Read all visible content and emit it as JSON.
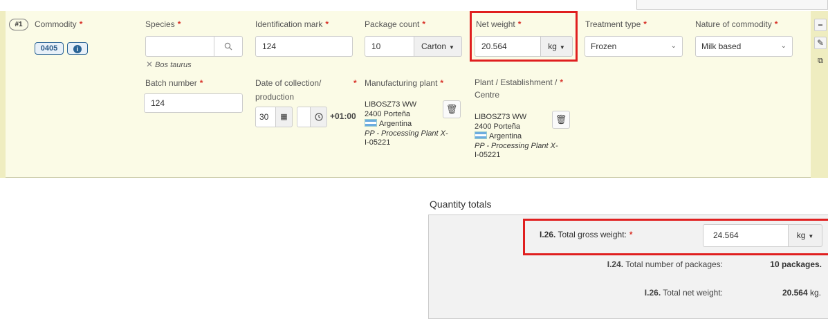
{
  "commodity_row": {
    "index": "#1",
    "commodity_label": "Commodity",
    "commodity_code": "0405",
    "info_icon": "info-icon",
    "species_label": "Species",
    "species_value": "",
    "species_selected": "Bos taurus",
    "id_mark_label": "Identification mark",
    "id_mark_value": "124",
    "package_count_label": "Package count",
    "package_count_value": "10",
    "package_unit": "Carton",
    "net_weight_label": "Net weight",
    "net_weight_value": "20.564",
    "net_weight_unit": "kg",
    "treatment_label": "Treatment type",
    "treatment_value": "Frozen",
    "nature_label": "Nature of commodity",
    "nature_value": "Milk based",
    "batch_label": "Batch number",
    "batch_value": "124",
    "date_label_line1": "Date of collection/",
    "date_label_line2": "production",
    "date_day_value": "30",
    "date_time_value": "",
    "timezone": "+01:00",
    "mfg_plant_label": "Manufacturing plant",
    "mfg_plant": {
      "name": "LIBOSZ73 WW",
      "city": "2400 Porteña",
      "country": "Argentina",
      "type_line1": "PP - Processing Plant X-",
      "type_line2": "I-05221"
    },
    "establishment_label_line1": "Plant / Establishment /",
    "establishment_label_line2": "Centre",
    "establishment": {
      "name": "LIBOSZ73 WW",
      "city": "2400 Porteña",
      "country": "Argentina",
      "type_line1": "PP - Processing Plant X-",
      "type_line2": "I-05221"
    }
  },
  "side_actions": [
    "minus-icon",
    "pencil-icon",
    "copy-icon"
  ],
  "totals": {
    "heading": "Quantity totals",
    "gross_code": "I.26.",
    "gross_label": "Total gross weight:",
    "gross_value": "24.564",
    "gross_unit": "kg",
    "packages_code": "I.24.",
    "packages_label": "Total number of packages:",
    "packages_value": "10 packages.",
    "net_code": "I.26.",
    "net_label": "Total net weight:",
    "net_value_number": "20.564",
    "net_value_unit": "kg."
  },
  "colors": {
    "highlight": "#e01f1f",
    "required": "#d9342b",
    "panel_bg": "#fbfbe6"
  }
}
